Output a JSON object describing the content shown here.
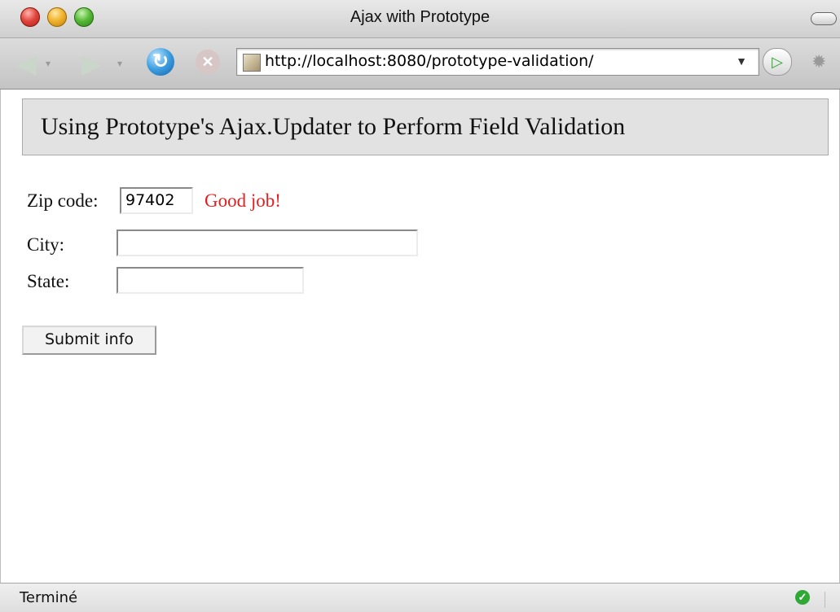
{
  "window": {
    "title": "Ajax with Prototype"
  },
  "toolbar": {
    "back_icon": "back-arrow-icon",
    "forward_icon": "forward-arrow-icon",
    "reload_icon": "reload-icon",
    "stop_icon": "stop-icon",
    "url": "http://localhost:8080/prototype-validation/",
    "go_icon": "go-play-icon",
    "throbber_icon": "spinner-icon"
  },
  "page": {
    "heading": "Using Prototype's Ajax.Updater to Perform Field Validation",
    "form": {
      "zip_label": "Zip code:",
      "zip_value": "97402",
      "zip_message": "Good job!",
      "city_label": "City:",
      "city_value": "",
      "state_label": "State:",
      "state_value": "",
      "submit_label": "Submit info"
    }
  },
  "status": {
    "text": "Terminé",
    "ok_icon": "check-circle-icon"
  },
  "colors": {
    "message": "#e02020",
    "header_bg": "#e2e2e2"
  }
}
